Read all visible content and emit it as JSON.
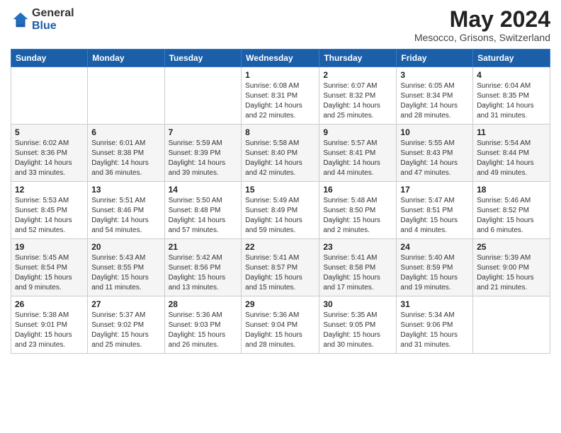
{
  "header": {
    "logo_general": "General",
    "logo_blue": "Blue",
    "month_title": "May 2024",
    "location": "Mesocco, Grisons, Switzerland"
  },
  "days_of_week": [
    "Sunday",
    "Monday",
    "Tuesday",
    "Wednesday",
    "Thursday",
    "Friday",
    "Saturday"
  ],
  "weeks": [
    [
      {
        "day": "",
        "sunrise": "",
        "sunset": "",
        "daylight": ""
      },
      {
        "day": "",
        "sunrise": "",
        "sunset": "",
        "daylight": ""
      },
      {
        "day": "",
        "sunrise": "",
        "sunset": "",
        "daylight": ""
      },
      {
        "day": "1",
        "sunrise": "Sunrise: 6:08 AM",
        "sunset": "Sunset: 8:31 PM",
        "daylight": "Daylight: 14 hours and 22 minutes."
      },
      {
        "day": "2",
        "sunrise": "Sunrise: 6:07 AM",
        "sunset": "Sunset: 8:32 PM",
        "daylight": "Daylight: 14 hours and 25 minutes."
      },
      {
        "day": "3",
        "sunrise": "Sunrise: 6:05 AM",
        "sunset": "Sunset: 8:34 PM",
        "daylight": "Daylight: 14 hours and 28 minutes."
      },
      {
        "day": "4",
        "sunrise": "Sunrise: 6:04 AM",
        "sunset": "Sunset: 8:35 PM",
        "daylight": "Daylight: 14 hours and 31 minutes."
      }
    ],
    [
      {
        "day": "5",
        "sunrise": "Sunrise: 6:02 AM",
        "sunset": "Sunset: 8:36 PM",
        "daylight": "Daylight: 14 hours and 33 minutes."
      },
      {
        "day": "6",
        "sunrise": "Sunrise: 6:01 AM",
        "sunset": "Sunset: 8:38 PM",
        "daylight": "Daylight: 14 hours and 36 minutes."
      },
      {
        "day": "7",
        "sunrise": "Sunrise: 5:59 AM",
        "sunset": "Sunset: 8:39 PM",
        "daylight": "Daylight: 14 hours and 39 minutes."
      },
      {
        "day": "8",
        "sunrise": "Sunrise: 5:58 AM",
        "sunset": "Sunset: 8:40 PM",
        "daylight": "Daylight: 14 hours and 42 minutes."
      },
      {
        "day": "9",
        "sunrise": "Sunrise: 5:57 AM",
        "sunset": "Sunset: 8:41 PM",
        "daylight": "Daylight: 14 hours and 44 minutes."
      },
      {
        "day": "10",
        "sunrise": "Sunrise: 5:55 AM",
        "sunset": "Sunset: 8:43 PM",
        "daylight": "Daylight: 14 hours and 47 minutes."
      },
      {
        "day": "11",
        "sunrise": "Sunrise: 5:54 AM",
        "sunset": "Sunset: 8:44 PM",
        "daylight": "Daylight: 14 hours and 49 minutes."
      }
    ],
    [
      {
        "day": "12",
        "sunrise": "Sunrise: 5:53 AM",
        "sunset": "Sunset: 8:45 PM",
        "daylight": "Daylight: 14 hours and 52 minutes."
      },
      {
        "day": "13",
        "sunrise": "Sunrise: 5:51 AM",
        "sunset": "Sunset: 8:46 PM",
        "daylight": "Daylight: 14 hours and 54 minutes."
      },
      {
        "day": "14",
        "sunrise": "Sunrise: 5:50 AM",
        "sunset": "Sunset: 8:48 PM",
        "daylight": "Daylight: 14 hours and 57 minutes."
      },
      {
        "day": "15",
        "sunrise": "Sunrise: 5:49 AM",
        "sunset": "Sunset: 8:49 PM",
        "daylight": "Daylight: 14 hours and 59 minutes."
      },
      {
        "day": "16",
        "sunrise": "Sunrise: 5:48 AM",
        "sunset": "Sunset: 8:50 PM",
        "daylight": "Daylight: 15 hours and 2 minutes."
      },
      {
        "day": "17",
        "sunrise": "Sunrise: 5:47 AM",
        "sunset": "Sunset: 8:51 PM",
        "daylight": "Daylight: 15 hours and 4 minutes."
      },
      {
        "day": "18",
        "sunrise": "Sunrise: 5:46 AM",
        "sunset": "Sunset: 8:52 PM",
        "daylight": "Daylight: 15 hours and 6 minutes."
      }
    ],
    [
      {
        "day": "19",
        "sunrise": "Sunrise: 5:45 AM",
        "sunset": "Sunset: 8:54 PM",
        "daylight": "Daylight: 15 hours and 9 minutes."
      },
      {
        "day": "20",
        "sunrise": "Sunrise: 5:43 AM",
        "sunset": "Sunset: 8:55 PM",
        "daylight": "Daylight: 15 hours and 11 minutes."
      },
      {
        "day": "21",
        "sunrise": "Sunrise: 5:42 AM",
        "sunset": "Sunset: 8:56 PM",
        "daylight": "Daylight: 15 hours and 13 minutes."
      },
      {
        "day": "22",
        "sunrise": "Sunrise: 5:41 AM",
        "sunset": "Sunset: 8:57 PM",
        "daylight": "Daylight: 15 hours and 15 minutes."
      },
      {
        "day": "23",
        "sunrise": "Sunrise: 5:41 AM",
        "sunset": "Sunset: 8:58 PM",
        "daylight": "Daylight: 15 hours and 17 minutes."
      },
      {
        "day": "24",
        "sunrise": "Sunrise: 5:40 AM",
        "sunset": "Sunset: 8:59 PM",
        "daylight": "Daylight: 15 hours and 19 minutes."
      },
      {
        "day": "25",
        "sunrise": "Sunrise: 5:39 AM",
        "sunset": "Sunset: 9:00 PM",
        "daylight": "Daylight: 15 hours and 21 minutes."
      }
    ],
    [
      {
        "day": "26",
        "sunrise": "Sunrise: 5:38 AM",
        "sunset": "Sunset: 9:01 PM",
        "daylight": "Daylight: 15 hours and 23 minutes."
      },
      {
        "day": "27",
        "sunrise": "Sunrise: 5:37 AM",
        "sunset": "Sunset: 9:02 PM",
        "daylight": "Daylight: 15 hours and 25 minutes."
      },
      {
        "day": "28",
        "sunrise": "Sunrise: 5:36 AM",
        "sunset": "Sunset: 9:03 PM",
        "daylight": "Daylight: 15 hours and 26 minutes."
      },
      {
        "day": "29",
        "sunrise": "Sunrise: 5:36 AM",
        "sunset": "Sunset: 9:04 PM",
        "daylight": "Daylight: 15 hours and 28 minutes."
      },
      {
        "day": "30",
        "sunrise": "Sunrise: 5:35 AM",
        "sunset": "Sunset: 9:05 PM",
        "daylight": "Daylight: 15 hours and 30 minutes."
      },
      {
        "day": "31",
        "sunrise": "Sunrise: 5:34 AM",
        "sunset": "Sunset: 9:06 PM",
        "daylight": "Daylight: 15 hours and 31 minutes."
      },
      {
        "day": "",
        "sunrise": "",
        "sunset": "",
        "daylight": ""
      }
    ]
  ]
}
